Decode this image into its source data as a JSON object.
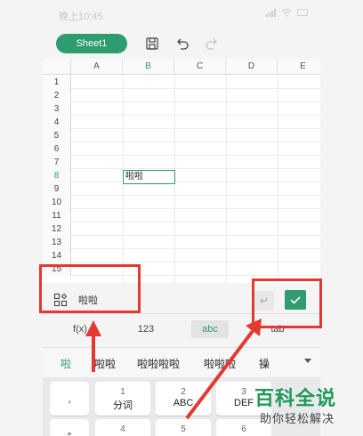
{
  "status_bar": {
    "time": "晚上10:45"
  },
  "toolbar": {
    "sheet_tab": "Sheet1",
    "icons": [
      "save-icon",
      "undo-icon",
      "redo-icon"
    ]
  },
  "grid": {
    "columns": [
      "A",
      "B",
      "C",
      "D",
      "E"
    ],
    "rows": [
      "1",
      "2",
      "3",
      "4",
      "5",
      "6",
      "7",
      "8",
      "9",
      "10",
      "11",
      "12",
      "13",
      "14",
      "15"
    ],
    "active_row": "8",
    "active_column": "B",
    "active_cell_value": "啦啦"
  },
  "formula_bar": {
    "value": "啦啦",
    "enter_symbol": "↵"
  },
  "mode_row": {
    "fx": "f(x)",
    "numeric": "123",
    "alpha": "abc",
    "tab": "tab"
  },
  "candidates": [
    "啦",
    "啦啦",
    "啦啦啦啦",
    "啦啦啦",
    "操"
  ],
  "keyboard": {
    "punct_top": ",",
    "punct_bottom": "°",
    "keys": [
      {
        "num": "1",
        "label": "分词"
      },
      {
        "num": "2",
        "label": "ABC"
      },
      {
        "num": "3",
        "label": "DEF"
      }
    ],
    "bottom_nums": [
      "4",
      "5",
      "6"
    ]
  },
  "watermark": {
    "title": "百科全说",
    "subtitle": "助你轻松解决"
  },
  "colors": {
    "accent": "#2e9c6e",
    "annotation": "#e23a33",
    "watermark": "#1f9a58"
  }
}
